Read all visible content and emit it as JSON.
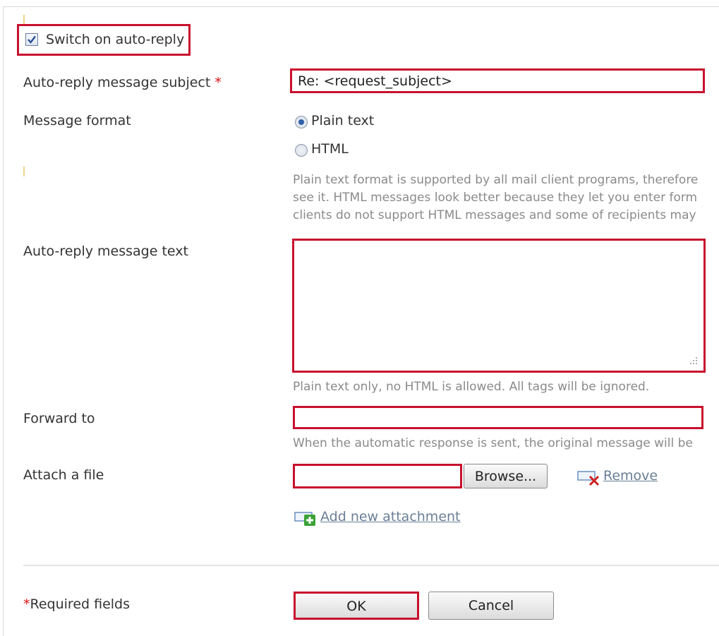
{
  "autoreply": {
    "checkbox_label": "Switch on auto-reply",
    "checked": true
  },
  "subject": {
    "label": "Auto-reply message subject",
    "required_mark": "*",
    "value": "Re: <request_subject>"
  },
  "format": {
    "label": "Message format",
    "options": [
      "Plain text",
      "HTML"
    ],
    "selected": "Plain text",
    "hint_lines": [
      "Plain text format is supported by all mail client programs, therefore",
      "see it. HTML messages look better because they let you enter form",
      "clients do not support HTML messages and some of recipients may"
    ]
  },
  "message": {
    "label": "Auto-reply message text",
    "value": "",
    "hint": "Plain text only, no HTML is allowed. All tags will be ignored."
  },
  "forward": {
    "label": "Forward to",
    "value": "",
    "hint": "When the automatic response is sent, the original message will be"
  },
  "attach": {
    "label": "Attach a file",
    "value": "",
    "browse": "Browse...",
    "remove": "Remove",
    "add": "Add new attachment"
  },
  "footer": {
    "required_mark": "*",
    "required_text": "Required fields",
    "ok": "OK",
    "cancel": "Cancel"
  },
  "colors": {
    "highlight": "#c8102e",
    "link": "#6a7f96"
  }
}
